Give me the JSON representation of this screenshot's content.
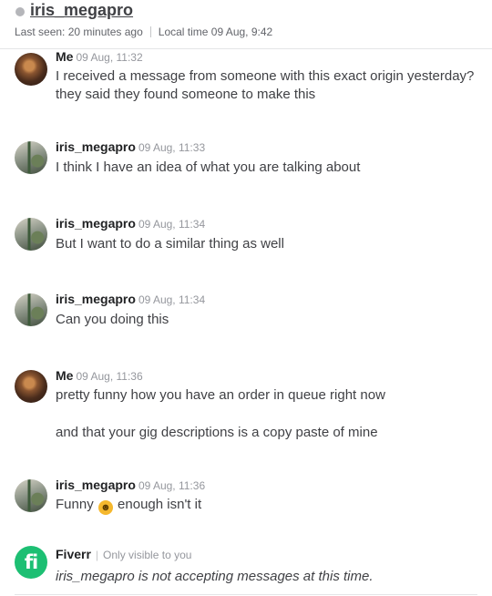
{
  "header": {
    "username": "iris_megapro",
    "last_seen": "Last seen: 20 minutes ago",
    "local_time": "Local time 09 Aug, 9:42"
  },
  "messages": [
    {
      "sender": "Me",
      "time": "09 Aug, 11:32",
      "avatar": "me-avatar",
      "lines": [
        "I received a message from someone with this exact origin yesterday?",
        "they said they found someone to make this"
      ]
    },
    {
      "sender": "iris_megapro",
      "time": "09 Aug, 11:33",
      "avatar": "iris-avatar",
      "lines": [
        "I think I have an idea of what you are talking about"
      ]
    },
    {
      "sender": "iris_megapro",
      "time": "09 Aug, 11:34",
      "avatar": "iris-avatar",
      "lines": [
        "But I want to do a similar thing as well"
      ]
    },
    {
      "sender": "iris_megapro",
      "time": "09 Aug, 11:34",
      "avatar": "iris-avatar",
      "lines": [
        "Can you doing this"
      ]
    },
    {
      "sender": "Me",
      "time": "09 Aug, 11:36",
      "avatar": "me-avatar",
      "lines": [
        "pretty funny how you have an order in queue right now",
        "and that your gig descriptions is a copy paste of mine"
      ]
    },
    {
      "sender": "iris_megapro",
      "time": "09 Aug, 11:36",
      "avatar": "iris-avatar",
      "line_before_emoji": "Funny",
      "emoji": "laughing-emoji",
      "line_after_emoji": "enough isn't it"
    }
  ],
  "system_message": {
    "sender": "Fiverr",
    "note": "Only visible to you",
    "text": "iris_megapro is not accepting messages at this time.",
    "logo_text": "fi"
  },
  "colors": {
    "brand_green": "#1dbf73",
    "text": "#404145",
    "muted": "#95979d",
    "status_offline": "#b5b6ba"
  }
}
